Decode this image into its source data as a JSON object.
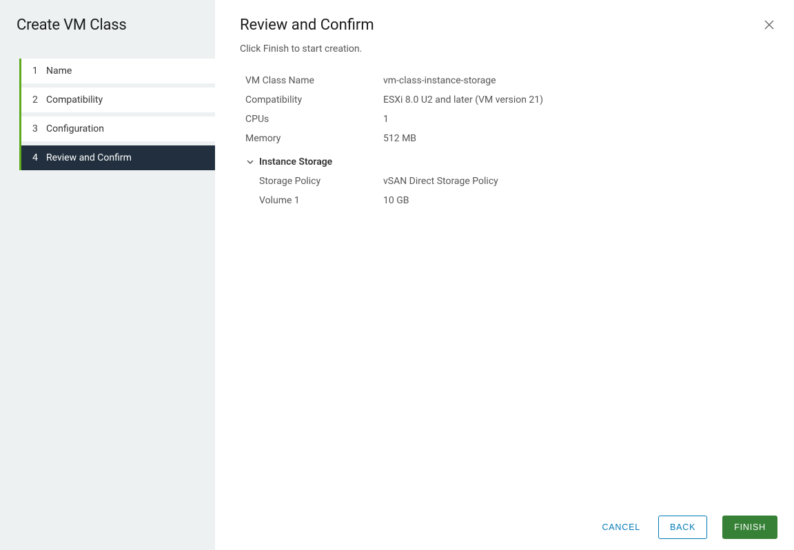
{
  "sidebar": {
    "title": "Create VM Class",
    "steps": [
      {
        "num": "1",
        "label": "Name",
        "active": false
      },
      {
        "num": "2",
        "label": "Compatibility",
        "active": false
      },
      {
        "num": "3",
        "label": "Configuration",
        "active": false
      },
      {
        "num": "4",
        "label": "Review and Confirm",
        "active": true
      }
    ]
  },
  "main": {
    "title": "Review and Confirm",
    "subtitle": "Click Finish to start creation.",
    "summary": [
      {
        "label": "VM Class Name",
        "value": "vm-class-instance-storage"
      },
      {
        "label": "Compatibility",
        "value": "ESXi 8.0 U2 and later (VM version 21)"
      },
      {
        "label": "CPUs",
        "value": "1"
      },
      {
        "label": "Memory",
        "value": "512 MB"
      }
    ],
    "instanceStorage": {
      "heading": "Instance Storage",
      "rows": [
        {
          "label": "Storage Policy",
          "value": "vSAN Direct Storage Policy"
        },
        {
          "label": "Volume 1",
          "value": "10 GB"
        }
      ]
    }
  },
  "footer": {
    "cancel": "CANCEL",
    "back": "BACK",
    "finish": "FINISH"
  }
}
